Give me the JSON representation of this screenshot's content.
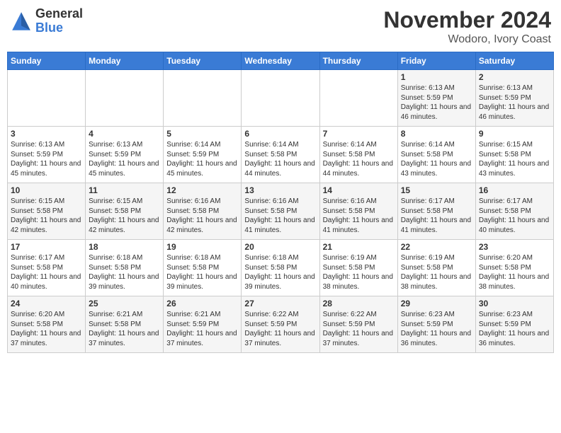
{
  "logo": {
    "general": "General",
    "blue": "Blue"
  },
  "title": "November 2024",
  "location": "Wodoro, Ivory Coast",
  "days_of_week": [
    "Sunday",
    "Monday",
    "Tuesday",
    "Wednesday",
    "Thursday",
    "Friday",
    "Saturday"
  ],
  "weeks": [
    [
      {
        "day": "",
        "content": ""
      },
      {
        "day": "",
        "content": ""
      },
      {
        "day": "",
        "content": ""
      },
      {
        "day": "",
        "content": ""
      },
      {
        "day": "",
        "content": ""
      },
      {
        "day": "1",
        "content": "Sunrise: 6:13 AM\nSunset: 5:59 PM\nDaylight: 11 hours and 46 minutes."
      },
      {
        "day": "2",
        "content": "Sunrise: 6:13 AM\nSunset: 5:59 PM\nDaylight: 11 hours and 46 minutes."
      }
    ],
    [
      {
        "day": "3",
        "content": "Sunrise: 6:13 AM\nSunset: 5:59 PM\nDaylight: 11 hours and 45 minutes."
      },
      {
        "day": "4",
        "content": "Sunrise: 6:13 AM\nSunset: 5:59 PM\nDaylight: 11 hours and 45 minutes."
      },
      {
        "day": "5",
        "content": "Sunrise: 6:14 AM\nSunset: 5:59 PM\nDaylight: 11 hours and 45 minutes."
      },
      {
        "day": "6",
        "content": "Sunrise: 6:14 AM\nSunset: 5:58 PM\nDaylight: 11 hours and 44 minutes."
      },
      {
        "day": "7",
        "content": "Sunrise: 6:14 AM\nSunset: 5:58 PM\nDaylight: 11 hours and 44 minutes."
      },
      {
        "day": "8",
        "content": "Sunrise: 6:14 AM\nSunset: 5:58 PM\nDaylight: 11 hours and 43 minutes."
      },
      {
        "day": "9",
        "content": "Sunrise: 6:15 AM\nSunset: 5:58 PM\nDaylight: 11 hours and 43 minutes."
      }
    ],
    [
      {
        "day": "10",
        "content": "Sunrise: 6:15 AM\nSunset: 5:58 PM\nDaylight: 11 hours and 42 minutes."
      },
      {
        "day": "11",
        "content": "Sunrise: 6:15 AM\nSunset: 5:58 PM\nDaylight: 11 hours and 42 minutes."
      },
      {
        "day": "12",
        "content": "Sunrise: 6:16 AM\nSunset: 5:58 PM\nDaylight: 11 hours and 42 minutes."
      },
      {
        "day": "13",
        "content": "Sunrise: 6:16 AM\nSunset: 5:58 PM\nDaylight: 11 hours and 41 minutes."
      },
      {
        "day": "14",
        "content": "Sunrise: 6:16 AM\nSunset: 5:58 PM\nDaylight: 11 hours and 41 minutes."
      },
      {
        "day": "15",
        "content": "Sunrise: 6:17 AM\nSunset: 5:58 PM\nDaylight: 11 hours and 41 minutes."
      },
      {
        "day": "16",
        "content": "Sunrise: 6:17 AM\nSunset: 5:58 PM\nDaylight: 11 hours and 40 minutes."
      }
    ],
    [
      {
        "day": "17",
        "content": "Sunrise: 6:17 AM\nSunset: 5:58 PM\nDaylight: 11 hours and 40 minutes."
      },
      {
        "day": "18",
        "content": "Sunrise: 6:18 AM\nSunset: 5:58 PM\nDaylight: 11 hours and 39 minutes."
      },
      {
        "day": "19",
        "content": "Sunrise: 6:18 AM\nSunset: 5:58 PM\nDaylight: 11 hours and 39 minutes."
      },
      {
        "day": "20",
        "content": "Sunrise: 6:18 AM\nSunset: 5:58 PM\nDaylight: 11 hours and 39 minutes."
      },
      {
        "day": "21",
        "content": "Sunrise: 6:19 AM\nSunset: 5:58 PM\nDaylight: 11 hours and 38 minutes."
      },
      {
        "day": "22",
        "content": "Sunrise: 6:19 AM\nSunset: 5:58 PM\nDaylight: 11 hours and 38 minutes."
      },
      {
        "day": "23",
        "content": "Sunrise: 6:20 AM\nSunset: 5:58 PM\nDaylight: 11 hours and 38 minutes."
      }
    ],
    [
      {
        "day": "24",
        "content": "Sunrise: 6:20 AM\nSunset: 5:58 PM\nDaylight: 11 hours and 37 minutes."
      },
      {
        "day": "25",
        "content": "Sunrise: 6:21 AM\nSunset: 5:58 PM\nDaylight: 11 hours and 37 minutes."
      },
      {
        "day": "26",
        "content": "Sunrise: 6:21 AM\nSunset: 5:59 PM\nDaylight: 11 hours and 37 minutes."
      },
      {
        "day": "27",
        "content": "Sunrise: 6:22 AM\nSunset: 5:59 PM\nDaylight: 11 hours and 37 minutes."
      },
      {
        "day": "28",
        "content": "Sunrise: 6:22 AM\nSunset: 5:59 PM\nDaylight: 11 hours and 37 minutes."
      },
      {
        "day": "29",
        "content": "Sunrise: 6:23 AM\nSunset: 5:59 PM\nDaylight: 11 hours and 36 minutes."
      },
      {
        "day": "30",
        "content": "Sunrise: 6:23 AM\nSunset: 5:59 PM\nDaylight: 11 hours and 36 minutes."
      }
    ]
  ]
}
